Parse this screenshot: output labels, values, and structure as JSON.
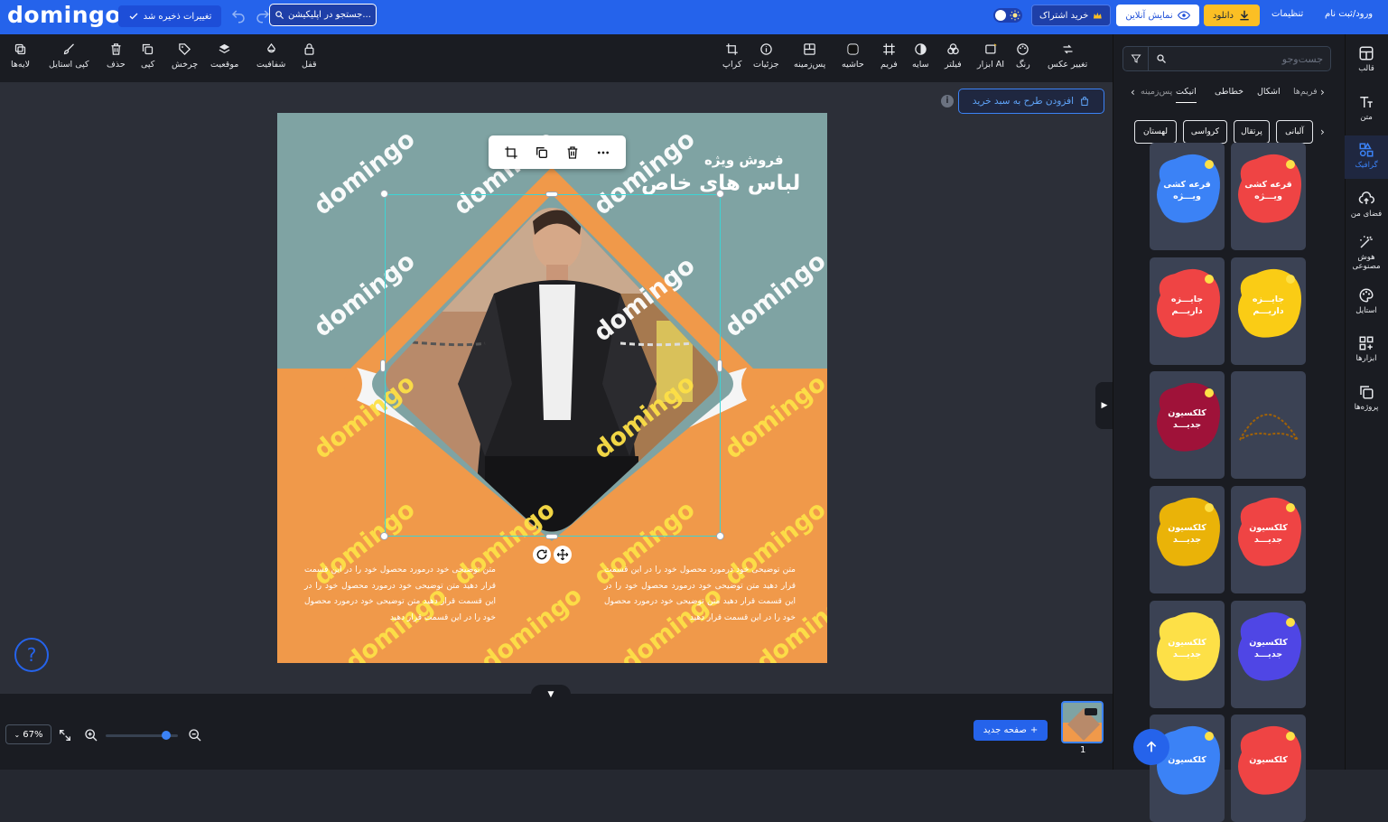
{
  "topbar": {
    "logo": "domingo",
    "saved_label": "تغییرات ذخیره شد",
    "search_value": "جستجو در اپلیکیشن...",
    "buy_label": "خرید اشتراک",
    "live_label": "نمایش آنلاین",
    "download_label": "دانلود",
    "settings_label": "تنظیمات",
    "login_label": "ورود/ثبت نام"
  },
  "toolbar": {
    "right": [
      "تغییر عکس",
      "رنگ",
      "ابزار AI",
      "فیلتر",
      "سایه",
      "فریم",
      "حاشیه",
      "پس‌زمینه",
      "جزئیات",
      "کراپ"
    ],
    "left": [
      "قفل",
      "شفافیت",
      "موقعیت",
      "چرخش",
      "کپی",
      "حذف",
      "کپی استایل",
      "لایه‌ها"
    ]
  },
  "canvas": {
    "add_design_label": "افزودن طرح به سبد خرید",
    "title_small": "فروش ویژه",
    "title_big": "لباس های خاص",
    "watermark": "domingo",
    "desc_text": "متن توضیحی خود درمورد محصول خود را در این قسمت قرار دهید متن توضیحی خود درمورد محصول خود را در این قسمت قرار دهید متن توضیحی خود درمورد محصول خود را در این قسمت قرار دهید"
  },
  "bottom": {
    "zoom": "67%",
    "new_page_label": "صفحه جدید",
    "page_number": "1"
  },
  "panel": {
    "search_placeholder": "جست‌وجو",
    "tabs": [
      "فریم‌ها",
      "اشکال",
      "خطاطی",
      "اتیکت",
      "پس‌زمینه"
    ],
    "active_tab": "اتیکت",
    "chips": [
      "آلبانی",
      "پرتقال",
      "کرواسی",
      "لهستان"
    ],
    "items": [
      {
        "text": "قرعه کشی\nویـــژه",
        "color": "#ef4444"
      },
      {
        "text": "قرعه کشی\nویـــژه",
        "color": "#3b82f6"
      },
      {
        "text": "جایـــزه\nداریـــم",
        "color": "#facc15"
      },
      {
        "text": "جایـــزه\nداریـــم",
        "color": "#ef4444"
      },
      {
        "text": "",
        "color": "#a16207"
      },
      {
        "text": "کلکسیون\nجدیـــد",
        "color": "#9f1239"
      },
      {
        "text": "کلکسیون\nجدیـــد",
        "color": "#ef4444"
      },
      {
        "text": "کلکسیون\nجدیـــد",
        "color": "#eab308"
      },
      {
        "text": "کلکسیون\nجدیـــد",
        "color": "#4f46e5"
      },
      {
        "text": "کلکسیون\nجدیـــد",
        "color": "#fde047"
      },
      {
        "text": "کلکسیون",
        "color": "#ef4444"
      },
      {
        "text": "کلکسیون",
        "color": "#3b82f6"
      }
    ]
  },
  "sidebar": [
    "قالب",
    "متن",
    "گرافیک",
    "فضای من",
    "هوش مصنوعی",
    "استایل",
    "ابزارها",
    "پروژه‌ها"
  ],
  "colors": {
    "brand": "#2563eb",
    "teal": "#7fa3a3",
    "orange": "#f0994a",
    "selection": "#3dd4d4"
  }
}
